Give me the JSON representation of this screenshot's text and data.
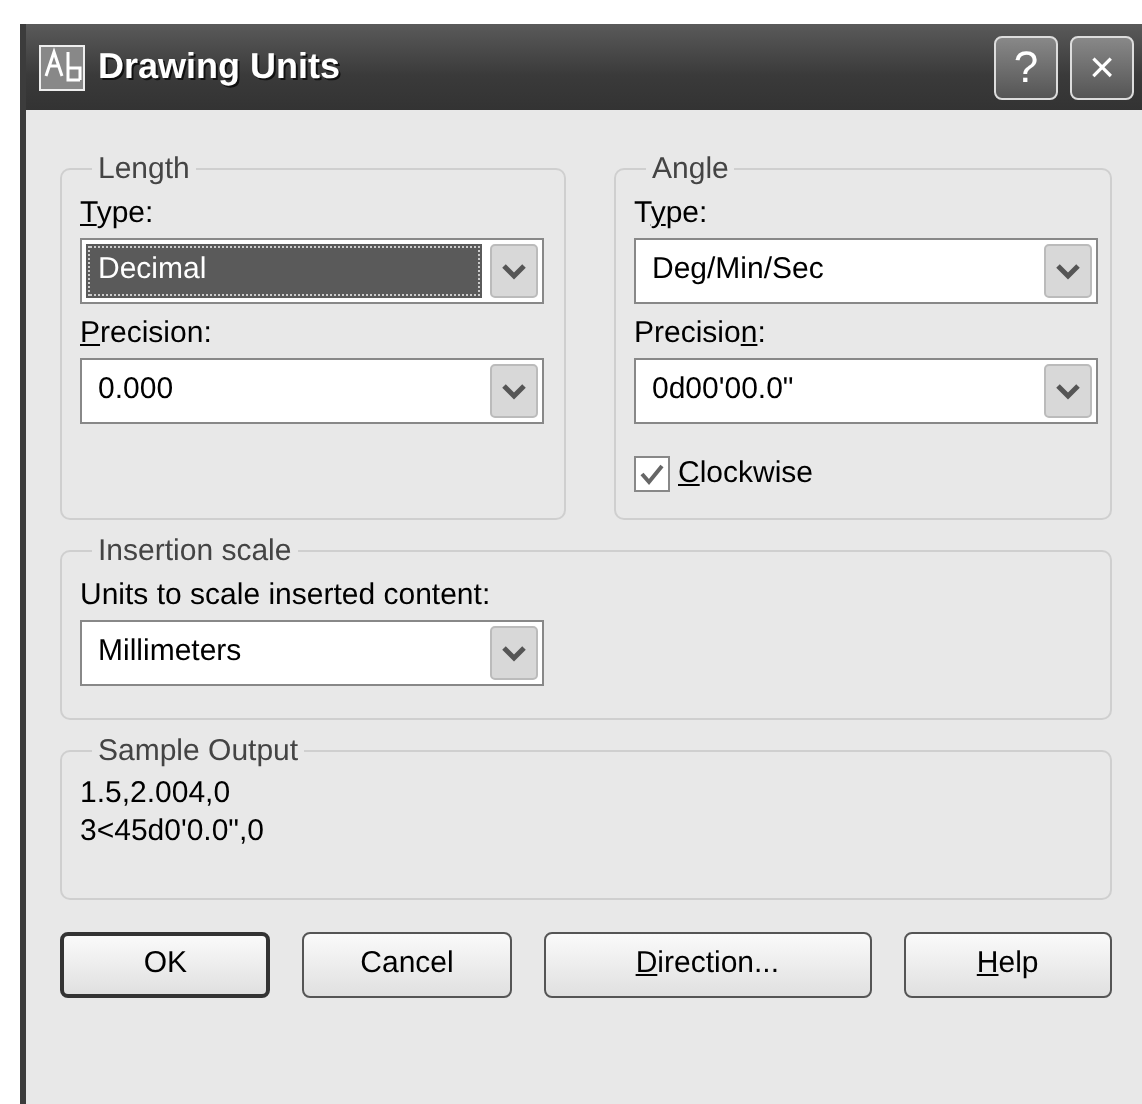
{
  "window": {
    "title": "Drawing Units",
    "title_buttons": [
      "?",
      "×"
    ]
  },
  "length": {
    "legend": "Length",
    "fields": [
      {
        "label": [
          {
            "text": "T",
            "underlined": true
          },
          {
            "text": "ype:",
            "underlined": false
          }
        ],
        "value": "Decimal",
        "focused": true
      },
      {
        "label": [
          {
            "text": "P",
            "underlined": true
          },
          {
            "text": "recision:",
            "underlined": false
          }
        ],
        "value": "0.000",
        "focused": false
      }
    ]
  },
  "angle": {
    "legend": "Angle",
    "fields": [
      {
        "label": [
          {
            "text": "T",
            "underlined": false
          },
          {
            "text": "y",
            "underlined": true
          },
          {
            "text": "pe:",
            "underlined": false
          }
        ],
        "value": "Deg/Min/Sec",
        "focused": false
      },
      {
        "label": [
          {
            "text": "Precisio",
            "underlined": false
          },
          {
            "text": "n",
            "underlined": true
          },
          {
            "text": ":",
            "underlined": false
          }
        ],
        "value": "0d00'00.0\"",
        "focused": false
      }
    ],
    "clockwise": {
      "label": [
        {
          "text": "C",
          "underlined": true
        },
        {
          "text": "lockwise",
          "underlined": false
        }
      ],
      "checked": true
    }
  },
  "insertion_scale": {
    "legend": "Insertion scale",
    "label": "Units to scale inserted content:",
    "value": "Millimeters"
  },
  "sample_output": {
    "legend": "Sample Output",
    "lines": [
      "1.5,2.004,0",
      "3<45d0'0.0\",0"
    ]
  },
  "buttons": [
    {
      "label": [
        {
          "text": "OK",
          "underlined": false
        }
      ],
      "default": true
    },
    {
      "label": [
        {
          "text": "Cancel",
          "underlined": false
        }
      ],
      "default": false
    },
    {
      "label": [
        {
          "text": "D",
          "underlined": true
        },
        {
          "text": "irection...",
          "underlined": false
        }
      ],
      "default": false
    },
    {
      "label": [
        {
          "text": "H",
          "underlined": true
        },
        {
          "text": "elp",
          "underlined": false
        }
      ],
      "default": false
    }
  ]
}
